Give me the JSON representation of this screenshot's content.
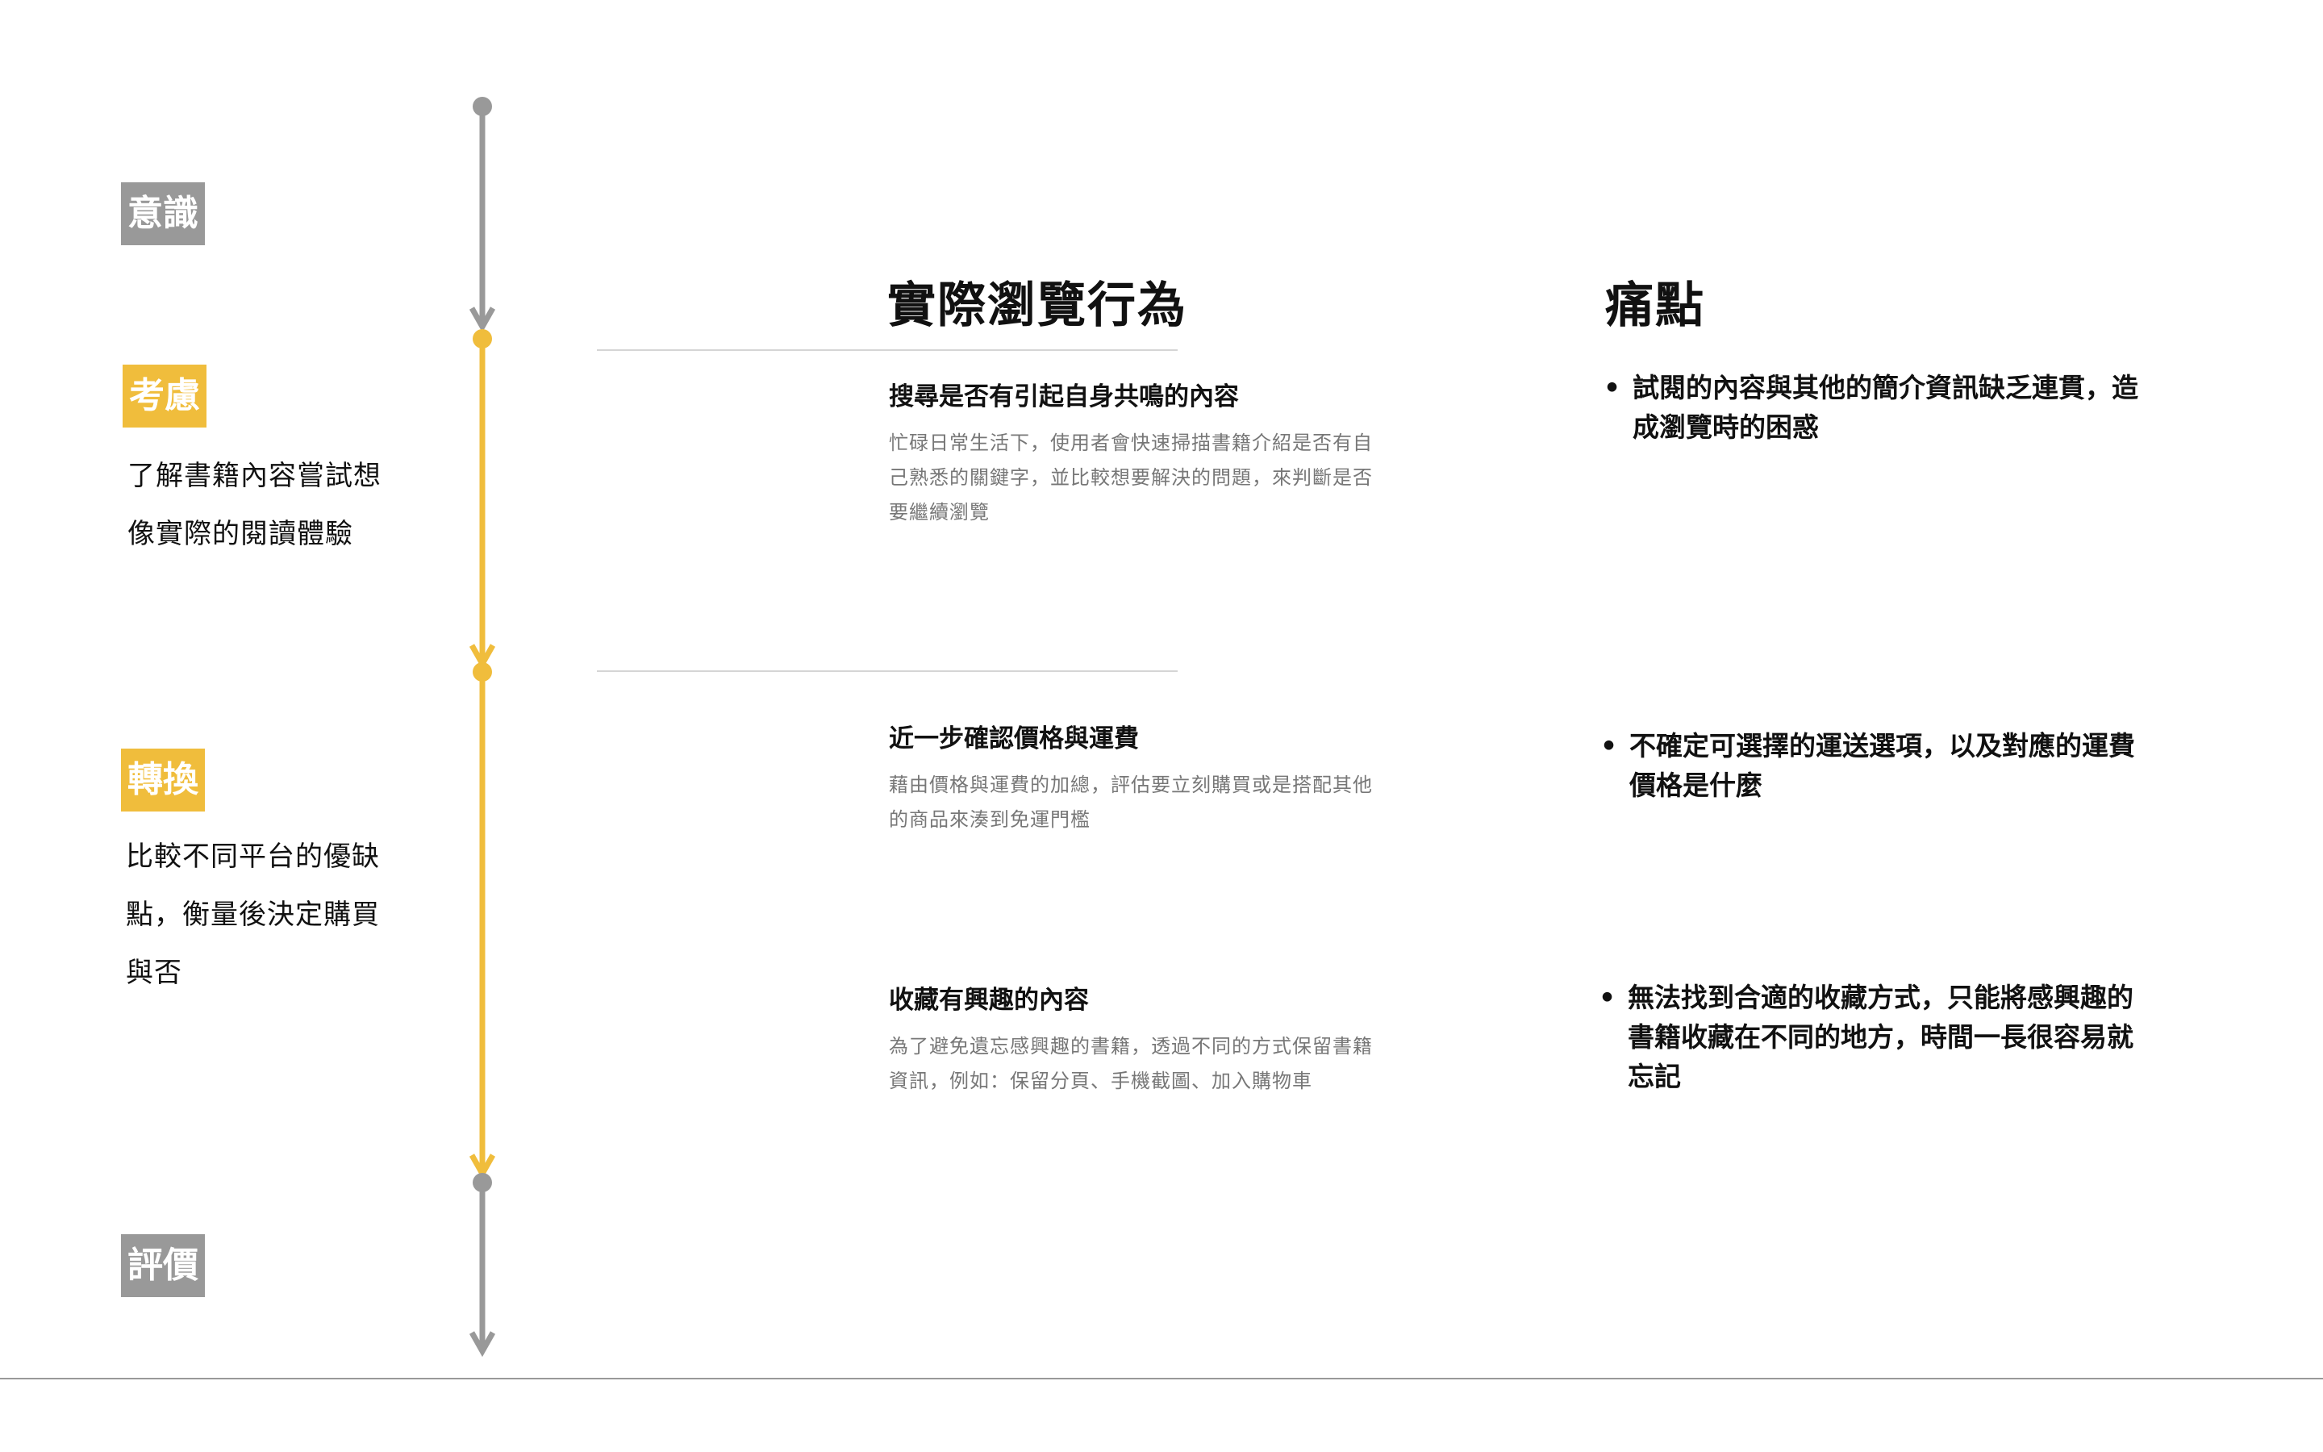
{
  "colors": {
    "gray": "#999999",
    "yellow": "#f0bd3c",
    "divider": "#d5d5d5"
  },
  "stages": {
    "awareness": {
      "label": "意識"
    },
    "consideration": {
      "label": "考慮",
      "desc": [
        "了解書籍內容嘗試想",
        "像實際的閱讀體驗"
      ]
    },
    "conversion": {
      "label": "轉換",
      "desc": [
        "比較不同平台的優缺",
        "點，衡量後決定購買",
        "與否"
      ]
    },
    "evaluation": {
      "label": "評價"
    }
  },
  "columns": {
    "behavior_header": "實際瀏覽行為",
    "pain_header": "痛點"
  },
  "behaviors": [
    {
      "title": "搜尋是否有引起自身共鳴的內容",
      "desc": "忙碌日常生活下，使用者會快速掃描書籍介紹是否有自己熟悉的關鍵字，並比較想要解決的問題，來判斷是否要繼續瀏覽"
    },
    {
      "title": "近一步確認價格與運費",
      "desc": "藉由價格與運費的加總，評估要立刻購買或是搭配其他的商品來湊到免運門檻"
    },
    {
      "title": "收藏有興趣的內容",
      "desc": "為了避免遺忘感興趣的書籍，透過不同的方式保留書籍資訊，例如：保留分頁、手機截圖、加入購物車"
    }
  ],
  "pain_points": [
    {
      "text": "試閱的內容與其他的簡介資訊缺乏連貫，造成瀏覽時的困惑"
    },
    {
      "text": "不確定可選擇的運送選項，以及對應的運費價格是什麼"
    },
    {
      "text": "無法找到合適的收藏方式，只能將感興趣的書籍收藏在不同的地方，時間一長很容易就忘記"
    }
  ],
  "bullet_char": "•"
}
